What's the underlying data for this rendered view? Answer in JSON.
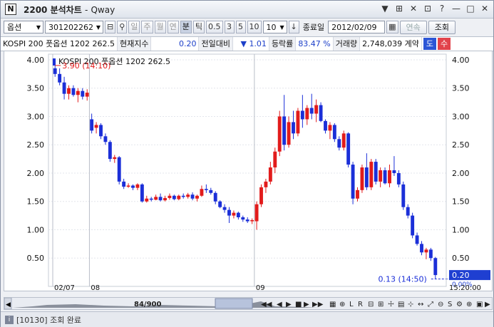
{
  "window": {
    "code": "2200",
    "title": "분석차트",
    "app": "Qway",
    "icon_letter": "N",
    "controls": [
      "▼",
      "⊞",
      "✕",
      "⊡",
      "?",
      "—",
      "□",
      "✕"
    ]
  },
  "toolbar": {
    "market_select": "옵션",
    "code_value": "301202262",
    "period_buttons": [
      "일",
      "주",
      "월",
      "연",
      "분",
      "틱"
    ],
    "active_period": "분",
    "interval_buttons": [
      "0.5",
      "3",
      "5",
      "10"
    ],
    "interval_value": "10",
    "date_label": "종료일",
    "date_value": "2012/02/09",
    "continuous_label": "연속",
    "query_label": "조회"
  },
  "infobar": {
    "name": "KOSPI 200 풋옵션 1202 262.5",
    "current_label": "현재지수",
    "current_value": "0.20",
    "change_label": "전일대비",
    "change_arrow": "▼",
    "change_value": "1.01",
    "rate_label": "등락률",
    "rate_value": "83.47 %",
    "volume_label": "거래량",
    "volume_value": "2,748,039",
    "volume_unit": "계약",
    "buy_label": "도",
    "sell_label": "수"
  },
  "chart_data": {
    "type": "candlestick",
    "title": "KOSPI 200 풋옵션 1202 262.5",
    "yaxis_ticks": [
      "4.00",
      "3.50",
      "3.00",
      "2.50",
      "2.00",
      "1.50",
      "1.00",
      "0.50"
    ],
    "ylim": [
      0,
      4.1
    ],
    "xaxis_labels": [
      "02/07",
      "08",
      "09"
    ],
    "time_label": "15:20:00",
    "current_price_label": "0.20",
    "below_label": "0.00%",
    "annotations": [
      {
        "text": "3.90 (14:10)",
        "type": "high"
      },
      {
        "text": "0.13 (14:50)",
        "type": "low"
      }
    ],
    "candles": [
      {
        "o": 3.85,
        "h": 3.95,
        "l": 3.7,
        "c": 3.75
      },
      {
        "o": 3.75,
        "h": 3.85,
        "l": 3.55,
        "c": 3.6
      },
      {
        "o": 3.6,
        "h": 3.7,
        "l": 3.3,
        "c": 3.4
      },
      {
        "o": 3.4,
        "h": 3.55,
        "l": 3.3,
        "c": 3.5
      },
      {
        "o": 3.5,
        "h": 3.55,
        "l": 3.35,
        "c": 3.38
      },
      {
        "o": 3.38,
        "h": 3.5,
        "l": 3.25,
        "c": 3.45
      },
      {
        "o": 3.45,
        "h": 3.5,
        "l": 3.3,
        "c": 3.35
      },
      {
        "o": 3.35,
        "h": 3.48,
        "l": 3.28,
        "c": 3.42
      },
      {
        "o": 2.95,
        "h": 3.05,
        "l": 2.7,
        "c": 2.75
      },
      {
        "o": 2.8,
        "h": 2.9,
        "l": 2.7,
        "c": 2.85
      },
      {
        "o": 2.85,
        "h": 2.88,
        "l": 2.6,
        "c": 2.65
      },
      {
        "o": 2.65,
        "h": 2.7,
        "l": 2.5,
        "c": 2.55
      },
      {
        "o": 2.55,
        "h": 2.58,
        "l": 2.2,
        "c": 2.25
      },
      {
        "o": 2.25,
        "h": 2.32,
        "l": 2.18,
        "c": 2.28
      },
      {
        "o": 2.28,
        "h": 2.3,
        "l": 1.8,
        "c": 1.85
      },
      {
        "o": 1.85,
        "h": 1.9,
        "l": 1.72,
        "c": 1.76
      },
      {
        "o": 1.76,
        "h": 1.82,
        "l": 1.74,
        "c": 1.78
      },
      {
        "o": 1.78,
        "h": 1.8,
        "l": 1.7,
        "c": 1.74
      },
      {
        "o": 1.74,
        "h": 1.82,
        "l": 1.7,
        "c": 1.8
      },
      {
        "o": 1.8,
        "h": 1.82,
        "l": 1.48,
        "c": 1.5
      },
      {
        "o": 1.5,
        "h": 1.6,
        "l": 1.48,
        "c": 1.55
      },
      {
        "o": 1.55,
        "h": 1.58,
        "l": 1.5,
        "c": 1.53
      },
      {
        "o": 1.53,
        "h": 1.62,
        "l": 1.52,
        "c": 1.58
      },
      {
        "o": 1.58,
        "h": 1.64,
        "l": 1.5,
        "c": 1.52
      },
      {
        "o": 1.52,
        "h": 1.6,
        "l": 1.5,
        "c": 1.56
      },
      {
        "o": 1.56,
        "h": 1.64,
        "l": 1.53,
        "c": 1.6
      },
      {
        "o": 1.6,
        "h": 1.62,
        "l": 1.52,
        "c": 1.54
      },
      {
        "o": 1.54,
        "h": 1.62,
        "l": 1.52,
        "c": 1.6
      },
      {
        "o": 1.6,
        "h": 1.64,
        "l": 1.55,
        "c": 1.58
      },
      {
        "o": 1.58,
        "h": 1.65,
        "l": 1.55,
        "c": 1.62
      },
      {
        "o": 1.62,
        "h": 1.66,
        "l": 1.52,
        "c": 1.55
      },
      {
        "o": 1.55,
        "h": 1.62,
        "l": 1.5,
        "c": 1.6
      },
      {
        "o": 1.6,
        "h": 1.78,
        "l": 1.58,
        "c": 1.72
      },
      {
        "o": 1.72,
        "h": 1.8,
        "l": 1.65,
        "c": 1.7
      },
      {
        "o": 1.7,
        "h": 1.74,
        "l": 1.62,
        "c": 1.65
      },
      {
        "o": 1.65,
        "h": 1.68,
        "l": 1.45,
        "c": 1.5
      },
      {
        "o": 1.5,
        "h": 1.52,
        "l": 1.38,
        "c": 1.4
      },
      {
        "o": 1.4,
        "h": 1.45,
        "l": 1.3,
        "c": 1.35
      },
      {
        "o": 1.35,
        "h": 1.4,
        "l": 1.12,
        "c": 1.25
      },
      {
        "o": 1.25,
        "h": 1.34,
        "l": 1.2,
        "c": 1.3
      },
      {
        "o": 1.3,
        "h": 1.32,
        "l": 1.18,
        "c": 1.22
      },
      {
        "o": 1.22,
        "h": 1.25,
        "l": 1.14,
        "c": 1.18
      },
      {
        "o": 1.18,
        "h": 1.22,
        "l": 1.12,
        "c": 1.15
      },
      {
        "o": 1.15,
        "h": 1.2,
        "l": 1.1,
        "c": 1.17
      },
      {
        "o": 1.15,
        "h": 1.5,
        "l": 1.0,
        "c": 1.45
      },
      {
        "o": 1.45,
        "h": 1.8,
        "l": 1.4,
        "c": 1.75
      },
      {
        "o": 1.75,
        "h": 1.9,
        "l": 1.65,
        "c": 1.85
      },
      {
        "o": 1.85,
        "h": 2.2,
        "l": 1.8,
        "c": 2.1
      },
      {
        "o": 2.1,
        "h": 2.45,
        "l": 2.0,
        "c": 2.38
      },
      {
        "o": 2.38,
        "h": 3.1,
        "l": 2.3,
        "c": 3.0
      },
      {
        "o": 3.0,
        "h": 3.38,
        "l": 2.4,
        "c": 2.5
      },
      {
        "o": 2.5,
        "h": 3.0,
        "l": 2.45,
        "c": 2.9
      },
      {
        "o": 2.9,
        "h": 3.1,
        "l": 2.6,
        "c": 2.7
      },
      {
        "o": 2.7,
        "h": 3.15,
        "l": 2.65,
        "c": 3.1
      },
      {
        "o": 3.1,
        "h": 3.38,
        "l": 2.8,
        "c": 2.95
      },
      {
        "o": 2.95,
        "h": 3.2,
        "l": 2.85,
        "c": 3.15
      },
      {
        "o": 3.15,
        "h": 3.4,
        "l": 2.95,
        "c": 3.05
      },
      {
        "o": 3.05,
        "h": 3.3,
        "l": 2.9,
        "c": 3.2
      },
      {
        "o": 3.2,
        "h": 3.25,
        "l": 2.9,
        "c": 2.92
      },
      {
        "o": 2.92,
        "h": 2.95,
        "l": 2.7,
        "c": 2.75
      },
      {
        "o": 2.75,
        "h": 2.9,
        "l": 2.6,
        "c": 2.85
      },
      {
        "o": 2.85,
        "h": 2.88,
        "l": 2.55,
        "c": 2.6
      },
      {
        "o": 2.6,
        "h": 2.65,
        "l": 2.4,
        "c": 2.45
      },
      {
        "o": 2.45,
        "h": 2.75,
        "l": 2.4,
        "c": 2.7
      },
      {
        "o": 2.7,
        "h": 2.72,
        "l": 2.1,
        "c": 2.15
      },
      {
        "o": 2.15,
        "h": 2.2,
        "l": 1.45,
        "c": 1.55
      },
      {
        "o": 1.55,
        "h": 1.75,
        "l": 1.5,
        "c": 1.7
      },
      {
        "o": 1.7,
        "h": 2.15,
        "l": 1.65,
        "c": 2.1
      },
      {
        "o": 2.1,
        "h": 2.35,
        "l": 1.7,
        "c": 1.75
      },
      {
        "o": 1.75,
        "h": 2.25,
        "l": 1.7,
        "c": 2.2
      },
      {
        "o": 2.2,
        "h": 2.25,
        "l": 1.8,
        "c": 1.85
      },
      {
        "o": 1.85,
        "h": 2.1,
        "l": 1.75,
        "c": 2.05
      },
      {
        "o": 2.05,
        "h": 2.1,
        "l": 1.8,
        "c": 1.82
      },
      {
        "o": 1.82,
        "h": 2.15,
        "l": 1.75,
        "c": 2.05
      },
      {
        "o": 2.05,
        "h": 2.3,
        "l": 1.95,
        "c": 2.0
      },
      {
        "o": 2.0,
        "h": 2.05,
        "l": 1.75,
        "c": 1.8
      },
      {
        "o": 1.8,
        "h": 1.85,
        "l": 1.35,
        "c": 1.4
      },
      {
        "o": 1.4,
        "h": 1.45,
        "l": 1.2,
        "c": 1.25
      },
      {
        "o": 1.25,
        "h": 1.3,
        "l": 0.85,
        "c": 0.9
      },
      {
        "o": 0.9,
        "h": 0.95,
        "l": 0.72,
        "c": 0.75
      },
      {
        "o": 0.75,
        "h": 0.8,
        "l": 0.55,
        "c": 0.6
      },
      {
        "o": 0.6,
        "h": 0.68,
        "l": 0.48,
        "c": 0.65
      },
      {
        "o": 0.65,
        "h": 0.68,
        "l": 0.45,
        "c": 0.5
      },
      {
        "o": 0.5,
        "h": 0.52,
        "l": 0.13,
        "c": 0.2
      }
    ]
  },
  "scroll": {
    "page_text": "84/900"
  },
  "status": {
    "message": "[10130] 조회 완료"
  }
}
